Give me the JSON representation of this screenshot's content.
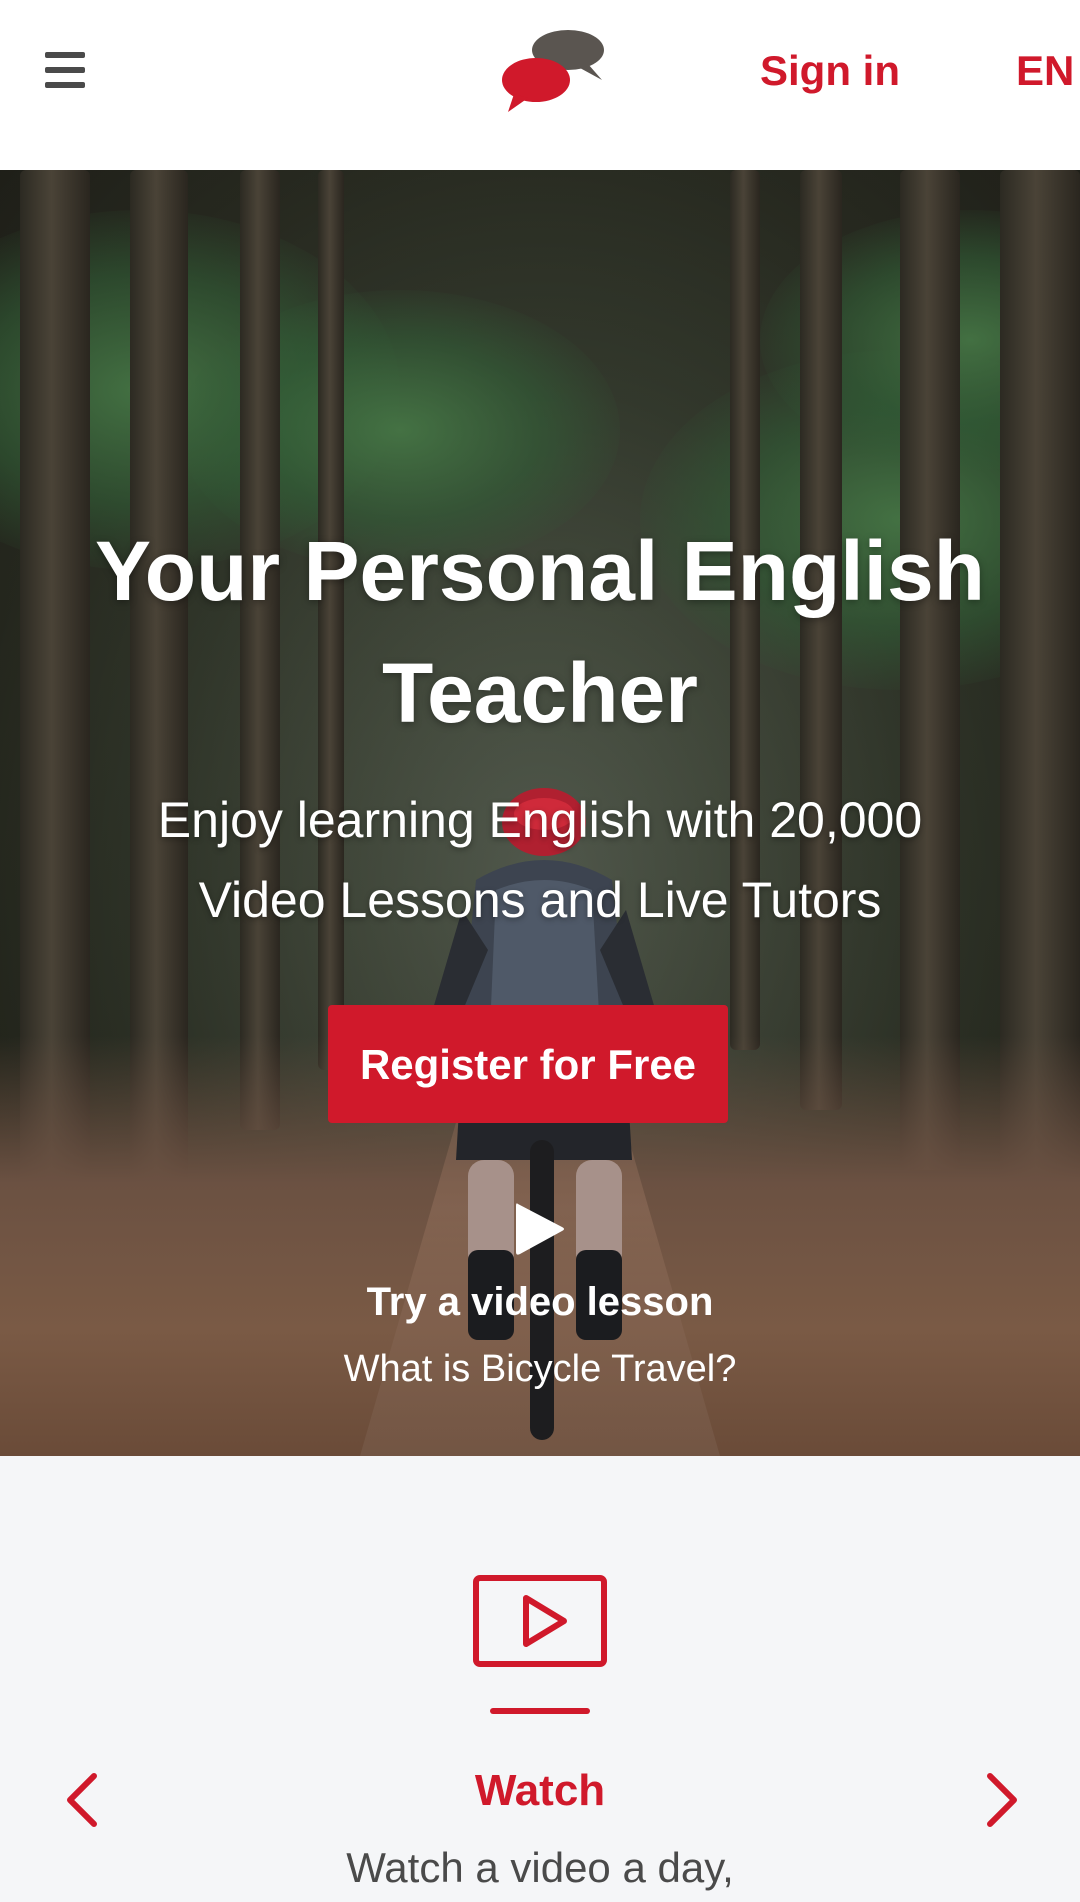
{
  "header": {
    "sign_in_label": "Sign in",
    "language_label": "EN"
  },
  "hero": {
    "title": "Your Personal English Teacher",
    "subtitle": "Enjoy learning English with 20,000 Video Lessons and Live Tutors",
    "register_label": "Register for Free",
    "try_lesson_label": "Try a video lesson",
    "lesson_name": "What is Bicycle Travel?"
  },
  "features": {
    "current": {
      "icon": "video-play-icon",
      "title": "Watch",
      "description": "Watch a video a day,"
    }
  },
  "colors": {
    "accent": "#d0192b",
    "logo_secondary": "#5a5550",
    "text_dark": "#4a4a4a",
    "background": "#f5f6f8"
  }
}
